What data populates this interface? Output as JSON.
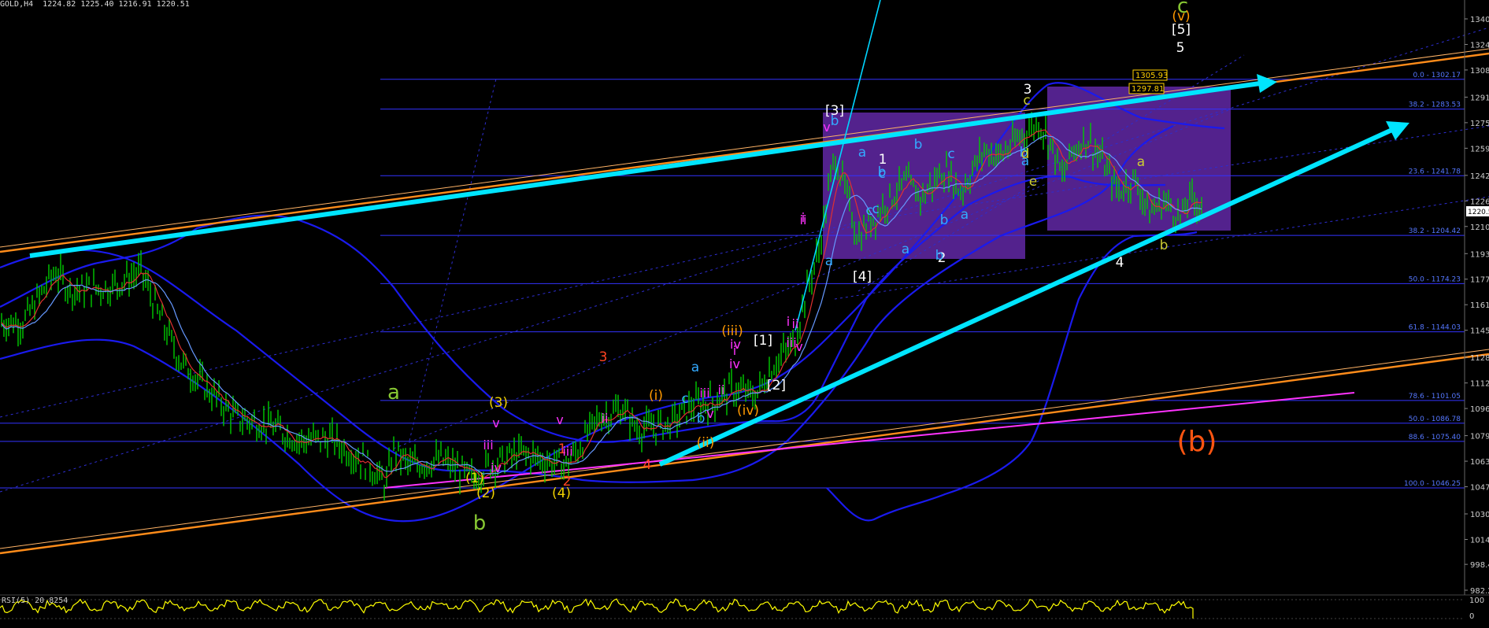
{
  "header": {
    "symbol_info": "GOLD,H4  1224.82 1225.40 1216.91 1220.51"
  },
  "rsi_label": "RSI(5) 20.8254",
  "colors": {
    "background": "#000000",
    "candle": "#00cc00",
    "fib_line": "#3333ff",
    "bollinger": "#1a1aee",
    "trend_arrow": "#00e5ff",
    "channel": "#ff8c1a",
    "magenta_line": "#ff33ff",
    "box_fill": "#6a2bb5",
    "rsi": "#ffff00"
  },
  "chart_data": {
    "type": "line",
    "instrument": "GOLD",
    "timeframe": "H4",
    "ohlc": {
      "open": 1224.82,
      "high": 1225.4,
      "low": 1216.91,
      "close": 1220.51
    },
    "current_price": "1220.5",
    "y_ticks": [
      "1340",
      "1324",
      "1308",
      "1291",
      "1275",
      "1259",
      "1242",
      "1226",
      "1210",
      "1193",
      "1177",
      "1161",
      "1145",
      "1128",
      "1112",
      "1096",
      "1079",
      "1063",
      "1047",
      "1030",
      "1014",
      "998.4",
      "982.2"
    ],
    "ylim": [
      982.2,
      1340
    ],
    "fib_levels": [
      {
        "label": "0.0 - 1302.17",
        "price": 1302.17
      },
      {
        "label": "38.2 - 1283.53",
        "price": 1283.53
      },
      {
        "label": "23.6 - 1241.78",
        "price": 1241.78
      },
      {
        "label": "38.2 - 1204.42",
        "price": 1204.42
      },
      {
        "label": "50.0 - 1174.23",
        "price": 1174.23
      },
      {
        "label": "61.8 - 1144.03",
        "price": 1144.03
      },
      {
        "label": "78.6 - 1101.05",
        "price": 1101.05
      },
      {
        "label": "50.0 - 1086.78",
        "price": 1086.78
      },
      {
        "label": "88.6 - 1075.40",
        "price": 1075.4
      },
      {
        "label": "100.0 - 1046.25",
        "price": 1046.25
      }
    ],
    "price_tags": [
      "1305.93",
      "1297.81"
    ],
    "rsi": {
      "value": 20.8254,
      "levels": [
        "100",
        "0"
      ]
    },
    "wave_labels": [
      {
        "text": "a",
        "color": "#88c833",
        "size": 26
      },
      {
        "text": "b",
        "color": "#88c833",
        "size": 26
      },
      {
        "text": "c",
        "color": "#88c833",
        "size": 26
      },
      {
        "text": "(b)",
        "color": "#ff5511",
        "size": 36
      },
      {
        "text": "(3)",
        "color": "#f0d000",
        "size": 17
      },
      {
        "text": "(1)",
        "color": "#f0d000",
        "size": 17
      },
      {
        "text": "(2)",
        "color": "#f0d000",
        "size": 17
      },
      {
        "text": "(4)",
        "color": "#f0d000",
        "size": 17
      },
      {
        "text": "(i)",
        "color": "#ff9900",
        "size": 17
      },
      {
        "text": "(iii)",
        "color": "#ff9900",
        "size": 17
      },
      {
        "text": "(iv)",
        "color": "#ff9900",
        "size": 17
      },
      {
        "text": "(ii)",
        "color": "#ff9900",
        "size": 17
      },
      {
        "text": "(v)",
        "color": "#ff9900",
        "size": 17
      },
      {
        "text": "[1]",
        "color": "#ffffff",
        "size": 17
      },
      {
        "text": "[2]",
        "color": "#ffffff",
        "size": 17
      },
      {
        "text": "[3]",
        "color": "#ffffff",
        "size": 17
      },
      {
        "text": "[4]",
        "color": "#ffffff",
        "size": 17
      },
      {
        "text": "[5]",
        "color": "#ffffff",
        "size": 17
      },
      {
        "text": "1",
        "color": "#ffffff",
        "size": 17
      },
      {
        "text": "2",
        "color": "#ffffff",
        "size": 17
      },
      {
        "text": "3",
        "color": "#ffffff",
        "size": 17
      },
      {
        "text": "4",
        "color": "#ffffff",
        "size": 17
      },
      {
        "text": "5",
        "color": "#ffffff",
        "size": 17
      },
      {
        "text": "3",
        "color": "#ff4422",
        "size": 17
      },
      {
        "text": "4",
        "color": "#ff4422",
        "size": 17
      },
      {
        "text": "2",
        "color": "#ff4422",
        "size": 17
      },
      {
        "text": "1",
        "color": "#ff4422",
        "size": 17
      },
      {
        "text": "v",
        "color": "#ff33ff",
        "size": 16
      },
      {
        "text": "iii",
        "color": "#ff33ff",
        "size": 16
      },
      {
        "text": "iv",
        "color": "#ff33ff",
        "size": 16
      },
      {
        "text": "i",
        "color": "#ff33ff",
        "size": 16
      },
      {
        "text": "ii",
        "color": "#ff33ff",
        "size": 16
      },
      {
        "text": "v",
        "color": "#ff33ff",
        "size": 16
      },
      {
        "text": "iii",
        "color": "#ff33ff",
        "size": 16
      },
      {
        "text": "iv",
        "color": "#ff33ff",
        "size": 16
      },
      {
        "text": "ii",
        "color": "#ff33ff",
        "size": 16
      },
      {
        "text": "iii",
        "color": "#ff33ff",
        "size": 16
      },
      {
        "text": "v",
        "color": "#ff33ff",
        "size": 16
      },
      {
        "text": "i",
        "color": "#ff33ff",
        "size": 16
      },
      {
        "text": "iv",
        "color": "#ff33ff",
        "size": 16
      },
      {
        "text": "ii",
        "color": "#ff33ff",
        "size": 16
      },
      {
        "text": "v",
        "color": "#ff33ff",
        "size": 16
      },
      {
        "text": "iii",
        "color": "#ff33ff",
        "size": 16
      },
      {
        "text": "i",
        "color": "#ff33ff",
        "size": 16
      },
      {
        "text": "ii",
        "color": "#ff33ff",
        "size": 16
      },
      {
        "text": "v",
        "color": "#ff33ff",
        "size": 16
      },
      {
        "text": "a",
        "color": "#33aaff",
        "size": 17
      },
      {
        "text": "b",
        "color": "#33aaff",
        "size": 17
      },
      {
        "text": "c",
        "color": "#33aaff",
        "size": 17
      },
      {
        "text": "a",
        "color": "#33aaff",
        "size": 17
      },
      {
        "text": "b",
        "color": "#33aaff",
        "size": 17
      },
      {
        "text": "c",
        "color": "#33aaff",
        "size": 17
      },
      {
        "text": "a",
        "color": "#33aaff",
        "size": 17
      },
      {
        "text": "b",
        "color": "#33aaff",
        "size": 17
      },
      {
        "text": "a",
        "color": "#33aaff",
        "size": 17
      },
      {
        "text": "b",
        "color": "#33aaff",
        "size": 17
      },
      {
        "text": "b",
        "color": "#33aaff",
        "size": 17
      },
      {
        "text": "c",
        "color": "#33aaff",
        "size": 17
      },
      {
        "text": "a",
        "color": "#33aaff",
        "size": 17
      },
      {
        "text": "b",
        "color": "#33aaff",
        "size": 17
      },
      {
        "text": "c",
        "color": "#33aaff",
        "size": 17
      },
      {
        "text": "c",
        "color": "#33aaff",
        "size": 17
      },
      {
        "text": "a",
        "color": "#33aaff",
        "size": 17
      },
      {
        "text": "b",
        "color": "#33aaff",
        "size": 17
      },
      {
        "text": "a",
        "color": "#cccc33",
        "size": 17
      },
      {
        "text": "b",
        "color": "#cccc33",
        "size": 17
      },
      {
        "text": "c",
        "color": "#cccc33",
        "size": 17
      },
      {
        "text": "d",
        "color": "#cccc33",
        "size": 17
      },
      {
        "text": "e",
        "color": "#cccc33",
        "size": 17
      }
    ]
  }
}
